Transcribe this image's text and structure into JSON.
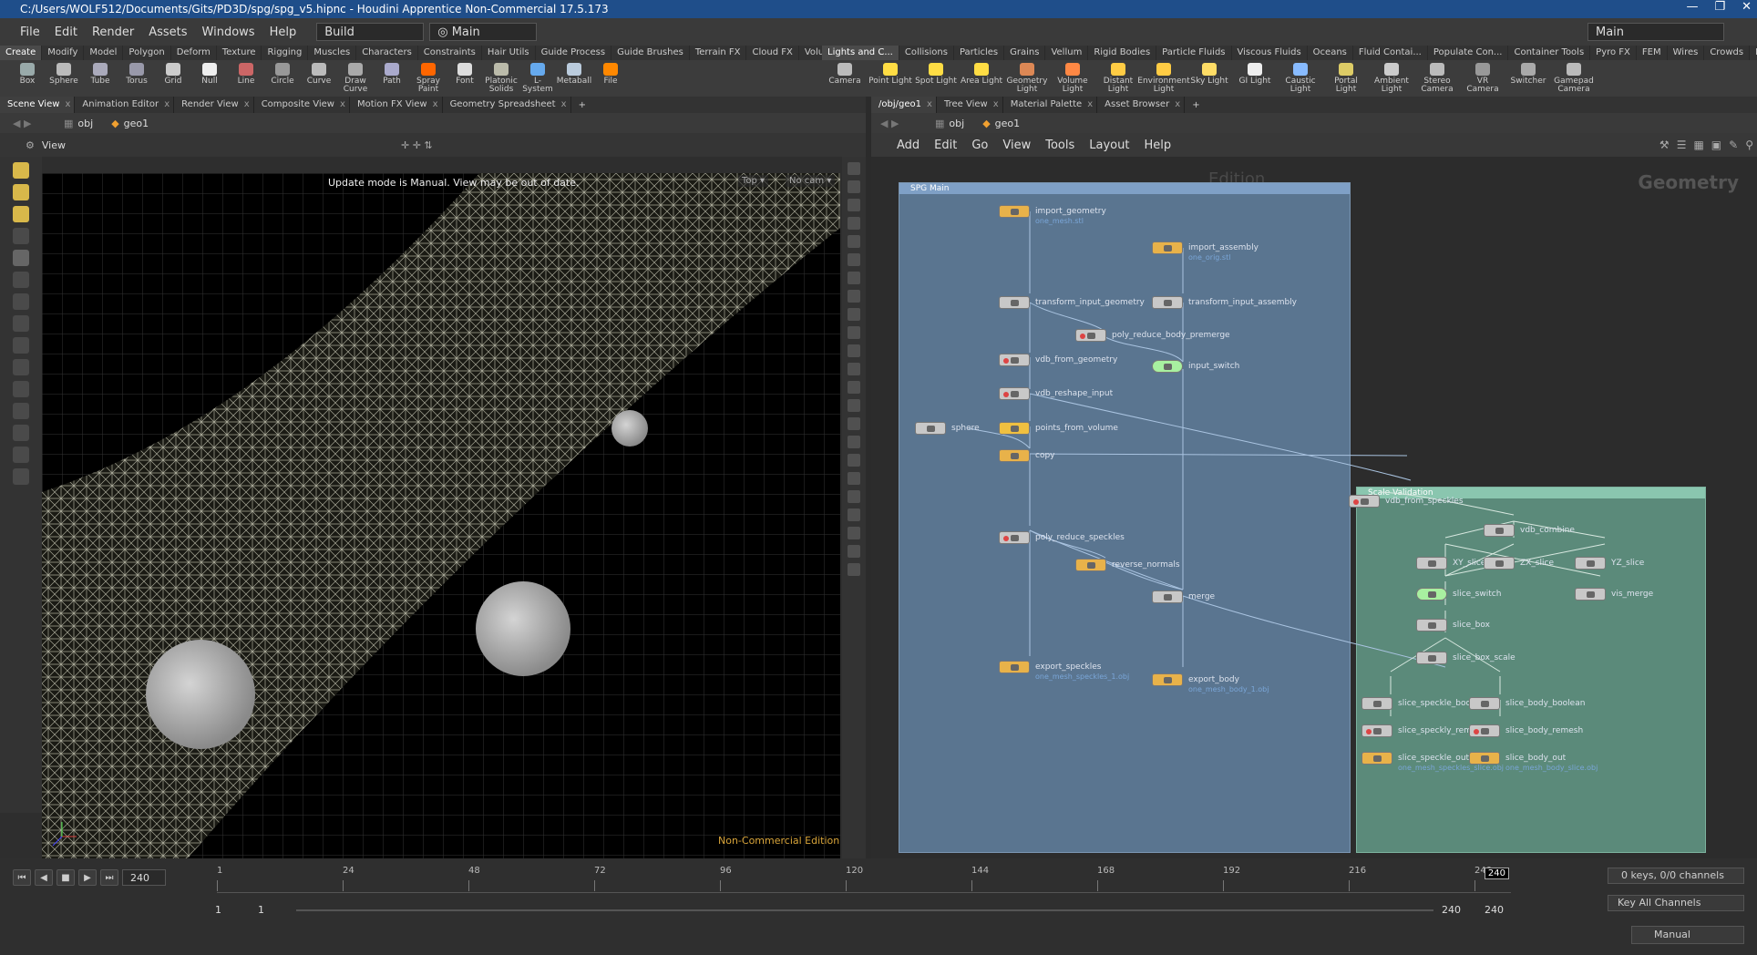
{
  "window": {
    "title": "C:/Users/WOLF512/Documents/Gits/PD3D/spg/spg_v5.hipnc - Houdini Apprentice Non-Commercial 17.5.173"
  },
  "menu": {
    "items": [
      "File",
      "Edit",
      "Render",
      "Assets",
      "Windows",
      "Help"
    ],
    "desktop": "Build",
    "context": "Main",
    "desktop_right": "Main"
  },
  "shelf_tabs_left": [
    "Create",
    "Modify",
    "Model",
    "Polygon",
    "Deform",
    "Texture",
    "Rigging",
    "Muscles",
    "Characters",
    "Constraints",
    "Hair Utils",
    "Guide Process",
    "Guide Brushes",
    "Terrain FX",
    "Cloud FX",
    "Volume"
  ],
  "shelf_tabs_right": [
    "Lights and C...",
    "Collisions",
    "Particles",
    "Grains",
    "Vellum",
    "Rigid Bodies",
    "Particle Fluids",
    "Viscous Fluids",
    "Oceans",
    "Fluid Contai...",
    "Populate Con...",
    "Container Tools",
    "Pyro FX",
    "FEM",
    "Wires",
    "Crowds",
    "Drive Simula..."
  ],
  "tools_left": [
    "Box",
    "Sphere",
    "Tube",
    "Torus",
    "Grid",
    "Null",
    "Line",
    "Circle",
    "Curve",
    "Draw Curve",
    "Path",
    "Spray Paint",
    "Font",
    "Platonic Solids",
    "L-System",
    "Metaball",
    "File"
  ],
  "tools_right": [
    "Camera",
    "Point Light",
    "Spot Light",
    "Area Light",
    "Geometry Light",
    "Volume Light",
    "Distant Light",
    "Environment Light",
    "Sky Light",
    "GI Light",
    "Caustic Light",
    "Portal Light",
    "Ambient Light",
    "Stereo Camera",
    "VR Camera",
    "Switcher",
    "Gamepad Camera"
  ],
  "left_pane": {
    "tabs": [
      "Scene View",
      "Animation Editor",
      "Render View",
      "Composite View",
      "Motion FX View",
      "Geometry Spreadsheet"
    ],
    "path": [
      "obj",
      "geo1"
    ],
    "view_label": "View",
    "update_msg": "Update mode is Manual. View may be out of date.",
    "view_top": "Top",
    "view_cam": "No cam",
    "watermark": "Non-Commercial Edition"
  },
  "right_pane": {
    "tabs": [
      "/obj/geo1",
      "Tree View",
      "Material Palette",
      "Asset Browser"
    ],
    "path": [
      "obj",
      "geo1"
    ],
    "menu": [
      "Add",
      "Edit",
      "Go",
      "View",
      "Tools",
      "Layout",
      "Help"
    ],
    "context_label": "Geometry",
    "watermark": "Edition"
  },
  "network": {
    "box_main": "SPG Main",
    "box_scale": "Scale Validation",
    "nodes": [
      {
        "label": "import_geometry",
        "sub": "one_mesh.stl"
      },
      {
        "label": "import_assembly",
        "sub": "one_orig.stl"
      },
      {
        "label": "transform_input_geometry",
        "sub": ""
      },
      {
        "label": "transform_input_assembly",
        "sub": ""
      },
      {
        "label": "poly_reduce_body_premerge",
        "sub": ""
      },
      {
        "label": "vdb_from_geometry",
        "sub": ""
      },
      {
        "label": "input_switch",
        "sub": ""
      },
      {
        "label": "vdb_reshape_input",
        "sub": ""
      },
      {
        "label": "sphere",
        "sub": ""
      },
      {
        "label": "points_from_volume",
        "sub": ""
      },
      {
        "label": "copy",
        "sub": ""
      },
      {
        "label": "poly_reduce_speckles",
        "sub": ""
      },
      {
        "label": "reverse_normals",
        "sub": ""
      },
      {
        "label": "merge",
        "sub": ""
      },
      {
        "label": "export_speckles",
        "sub": "one_mesh_speckles_1.obj"
      },
      {
        "label": "export_body",
        "sub": "one_mesh_body_1.obj"
      },
      {
        "label": "vdb_from_speckles",
        "sub": ""
      },
      {
        "label": "vdb_combine",
        "sub": ""
      },
      {
        "label": "XY_slice",
        "sub": ""
      },
      {
        "label": "ZX_slice",
        "sub": ""
      },
      {
        "label": "YZ_slice",
        "sub": ""
      },
      {
        "label": "slice_switch",
        "sub": ""
      },
      {
        "label": "vis_merge",
        "sub": ""
      },
      {
        "label": "slice_box",
        "sub": ""
      },
      {
        "label": "slice_box_scale",
        "sub": ""
      },
      {
        "label": "slice_speckle_boolean",
        "sub": ""
      },
      {
        "label": "slice_body_boolean",
        "sub": ""
      },
      {
        "label": "slice_speckly_remesh",
        "sub": ""
      },
      {
        "label": "slice_body_remesh",
        "sub": ""
      },
      {
        "label": "slice_speckle_out",
        "sub": "one_mesh_speckles_slice.obj"
      },
      {
        "label": "slice_body_out",
        "sub": "one_mesh_body_slice.obj"
      }
    ]
  },
  "timeline": {
    "current_frame": "240",
    "ticks": [
      "1",
      "24",
      "48",
      "72",
      "96",
      "120",
      "144",
      "168",
      "192",
      "216",
      "240"
    ],
    "range_start": "1",
    "range_start2": "1",
    "range_end": "240",
    "range_end2": "240",
    "keys_label": "0 keys, 0/0 channels",
    "key_all": "Key All Channels",
    "update_mode": "Manual"
  }
}
